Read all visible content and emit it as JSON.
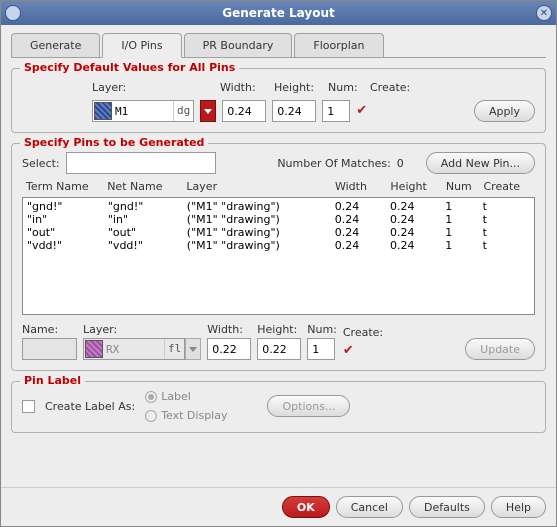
{
  "window": {
    "title": "Generate Layout"
  },
  "tabs": {
    "generate": "Generate",
    "iopins": "I/O Pins",
    "prboundary": "PR Boundary",
    "floorplan": "Floorplan"
  },
  "defaults": {
    "title": "Specify Default Values for All Pins",
    "layer_label": "Layer:",
    "width_label": "Width:",
    "height_label": "Height:",
    "num_label": "Num:",
    "create_label": "Create:",
    "layer_value": "M1",
    "layer_suffix": "dg",
    "width": "0.24",
    "height": "0.24",
    "num": "1",
    "apply": "Apply"
  },
  "gen": {
    "title": "Specify Pins to be Generated",
    "select_label": "Select:",
    "select_value": "",
    "matches_label": "Number Of Matches:",
    "matches_value": "0",
    "add_pin": "Add New Pin...",
    "cols": {
      "term": "Term Name",
      "net": "Net Name",
      "layer": "Layer",
      "width": "Width",
      "height": "Height",
      "num": "Num",
      "create": "Create"
    },
    "rows": [
      {
        "term": "\"gnd!\"",
        "net": "\"gnd!\"",
        "layer": "(\"M1\" \"drawing\")",
        "width": "0.24",
        "height": "0.24",
        "num": "1",
        "create": "t"
      },
      {
        "term": "\"in\"",
        "net": "\"in\"",
        "layer": "(\"M1\" \"drawing\")",
        "width": "0.24",
        "height": "0.24",
        "num": "1",
        "create": "t"
      },
      {
        "term": "\"out\"",
        "net": "\"out\"",
        "layer": "(\"M1\" \"drawing\")",
        "width": "0.24",
        "height": "0.24",
        "num": "1",
        "create": "t"
      },
      {
        "term": "\"vdd!\"",
        "net": "\"vdd!\"",
        "layer": "(\"M1\" \"drawing\")",
        "width": "0.24",
        "height": "0.24",
        "num": "1",
        "create": "t"
      }
    ],
    "edit": {
      "name_label": "Name:",
      "name_value": "",
      "layer_label": "Layer:",
      "layer_value": "RX",
      "layer_suffix": "fl",
      "width_label": "Width:",
      "width": "0.22",
      "height_label": "Height:",
      "height": "0.22",
      "num_label": "Num:",
      "num": "1",
      "create_label": "Create:",
      "update": "Update"
    }
  },
  "pinlabel": {
    "title": "Pin Label",
    "create_as": "Create Label As:",
    "label": "Label",
    "text_display": "Text Display",
    "options": "Options..."
  },
  "footer": {
    "ok": "OK",
    "cancel": "Cancel",
    "defaults": "Defaults",
    "help": "Help"
  }
}
